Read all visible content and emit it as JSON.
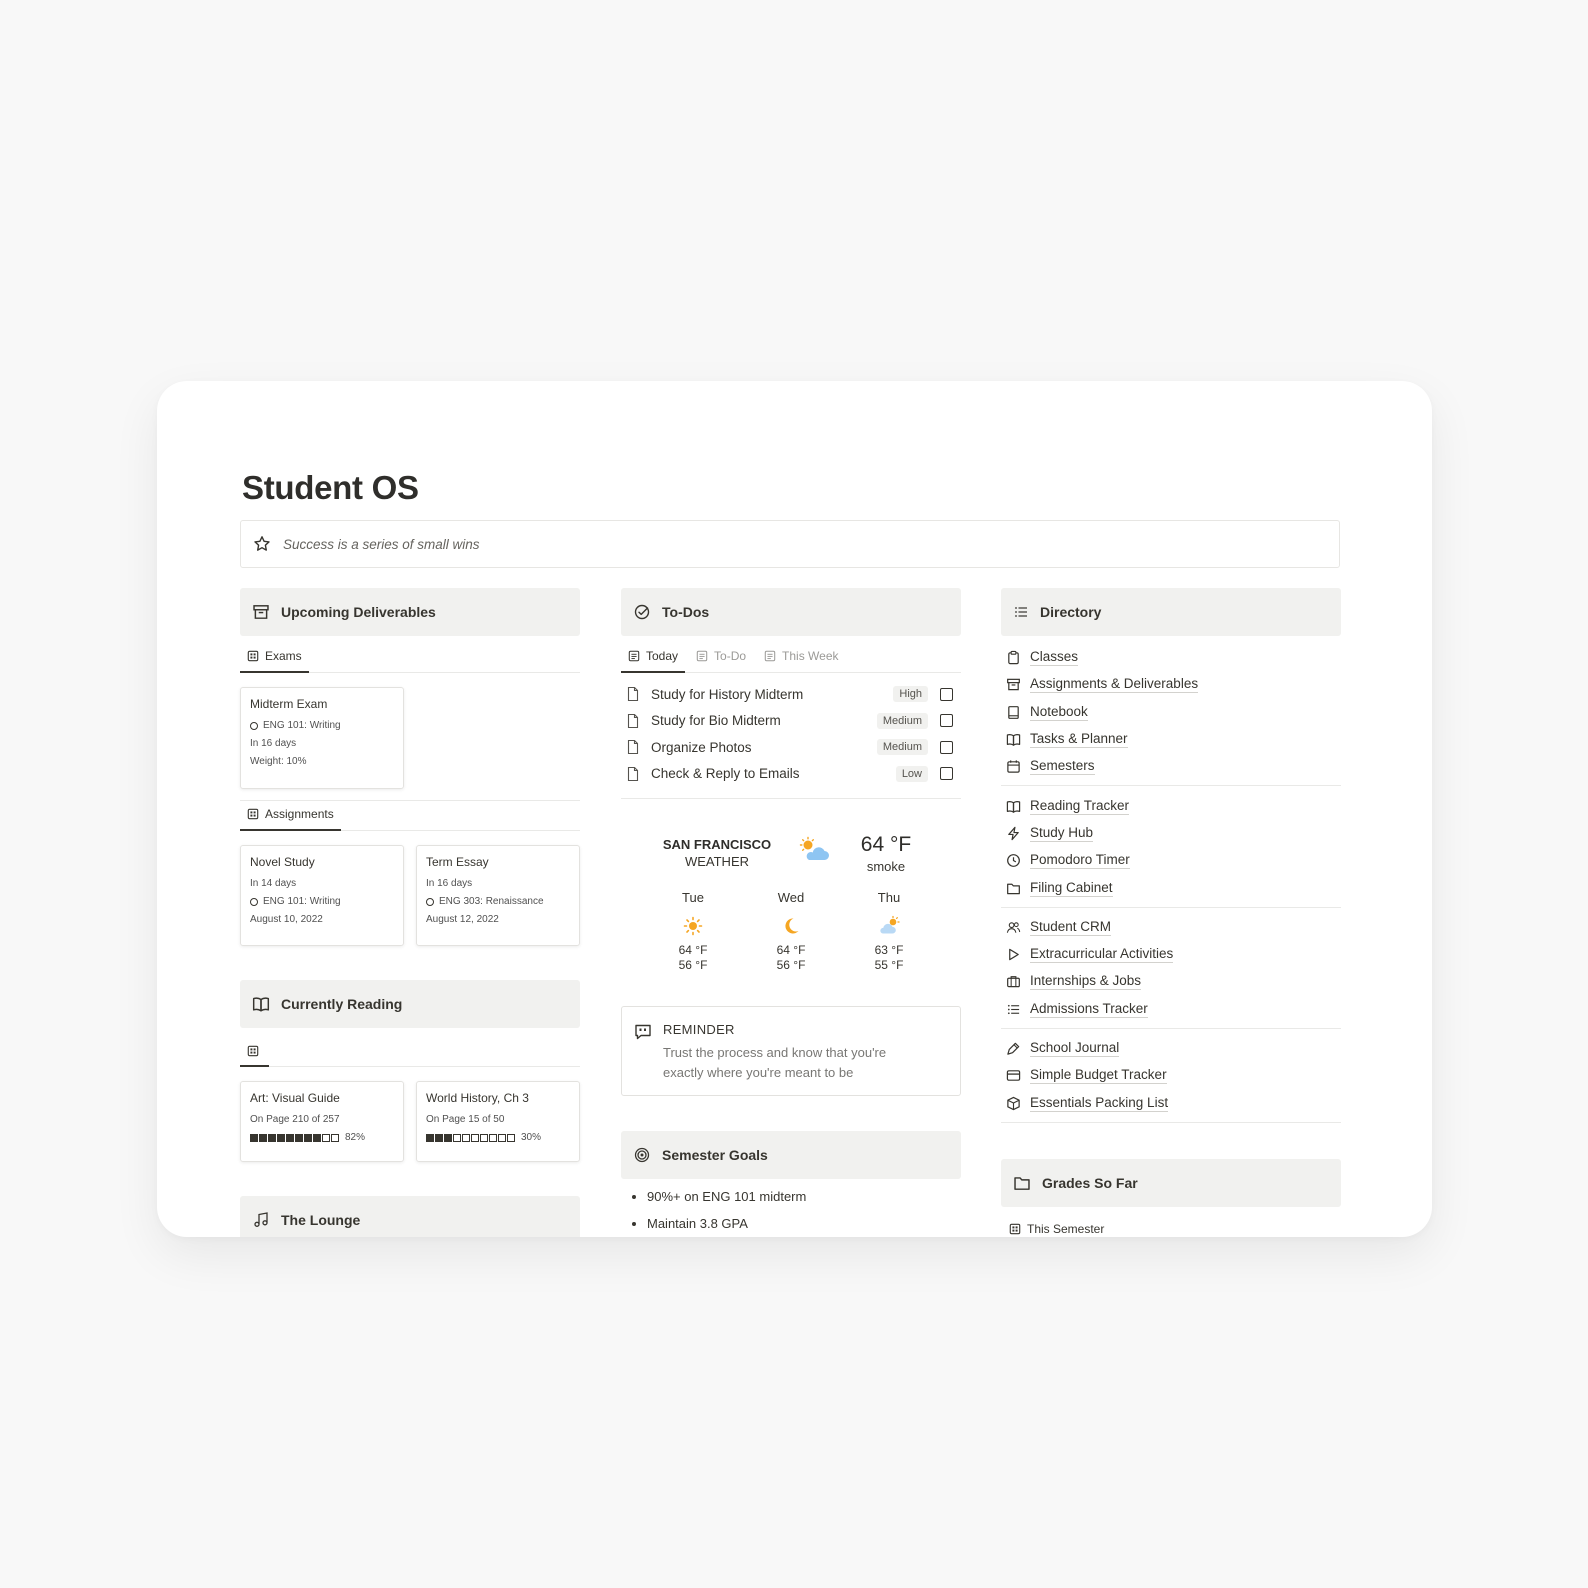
{
  "page": {
    "title": "Student OS",
    "quote": "Success is a series of small wins"
  },
  "deliverables": {
    "header": "Upcoming Deliverables",
    "exams_tab": "Exams",
    "exams": [
      {
        "title": "Midterm Exam",
        "class": "ENG 101: Writing",
        "due": "In 16 days",
        "weight": "Weight: 10%"
      }
    ],
    "assignments_tab": "Assignments",
    "assignments": [
      {
        "title": "Novel Study",
        "due": "In 14 days",
        "class": "ENG 101: Writing",
        "date": "August 10, 2022"
      },
      {
        "title": "Term Essay",
        "due": "In 16 days",
        "class": "ENG 303: Renaissance",
        "date": "August 12, 2022"
      }
    ]
  },
  "reading": {
    "header": "Currently Reading",
    "books": [
      {
        "title": "Art: Visual Guide",
        "page": "On Page 210 of 257",
        "progress": 0.82,
        "percent": "82%"
      },
      {
        "title": "World History, Ch 3",
        "page": "On Page 15 of 50",
        "progress": 0.3,
        "percent": "30%"
      }
    ]
  },
  "lounge": {
    "header": "The Lounge"
  },
  "todos": {
    "header": "To-Dos",
    "tabs": [
      "Today",
      "To-Do",
      "This Week"
    ],
    "items": [
      {
        "label": "Study for History Midterm",
        "priority": "High",
        "done": false
      },
      {
        "label": "Study for Bio Midterm",
        "priority": "Medium",
        "done": false
      },
      {
        "label": "Organize Photos",
        "priority": "Medium",
        "done": false
      },
      {
        "label": "Check & Reply to Emails",
        "priority": "Low",
        "done": false
      }
    ]
  },
  "weather": {
    "city": "SAN FRANCISCO",
    "subtitle": "WEATHER",
    "temp": "64 °F",
    "condition": "smoke",
    "days": [
      {
        "name": "Tue",
        "icon": "sun-icon",
        "hi": "64 °F",
        "lo": "56 °F"
      },
      {
        "name": "Wed",
        "icon": "moon-icon",
        "hi": "64 °F",
        "lo": "56 °F"
      },
      {
        "name": "Thu",
        "icon": "cloud-sun-icon",
        "hi": "63 °F",
        "lo": "55 °F"
      }
    ]
  },
  "reminder": {
    "title": "REMINDER",
    "body": "Trust the process and know that you're exactly where you're meant to be"
  },
  "goals": {
    "header": "Semester Goals",
    "items": [
      "90%+ on ENG 101 midterm",
      "Maintain 3.8 GPA"
    ]
  },
  "directory": {
    "header": "Directory",
    "groups": [
      [
        {
          "label": "Classes",
          "icon": "clipboard-icon"
        },
        {
          "label": "Assignments & Deliverables",
          "icon": "archive-icon"
        },
        {
          "label": "Notebook",
          "icon": "notebook-icon"
        },
        {
          "label": "Tasks & Planner",
          "icon": "book-open-icon"
        },
        {
          "label": "Semesters",
          "icon": "calendar-icon"
        }
      ],
      [
        {
          "label": "Reading Tracker",
          "icon": "book-open-icon"
        },
        {
          "label": "Study Hub",
          "icon": "lightning-icon"
        },
        {
          "label": "Pomodoro Timer",
          "icon": "clock-icon"
        },
        {
          "label": "Filing Cabinet",
          "icon": "folder-icon"
        }
      ],
      [
        {
          "label": "Student CRM",
          "icon": "users-icon"
        },
        {
          "label": "Extracurricular Activities",
          "icon": "play-icon"
        },
        {
          "label": "Internships & Jobs",
          "icon": "briefcase-icon"
        },
        {
          "label": "Admissions Tracker",
          "icon": "list-icon"
        }
      ],
      [
        {
          "label": "School Journal",
          "icon": "pen-icon"
        },
        {
          "label": "Simple Budget Tracker",
          "icon": "credit-card-icon"
        },
        {
          "label": "Essentials Packing List",
          "icon": "package-icon"
        }
      ]
    ]
  },
  "grades": {
    "header": "Grades So Far",
    "tab": "This Semester"
  },
  "colors": {
    "text": "#37352f",
    "header_bg": "#f1f1ef",
    "sun": "#f5a623",
    "cloud": "#8ec5f2"
  }
}
